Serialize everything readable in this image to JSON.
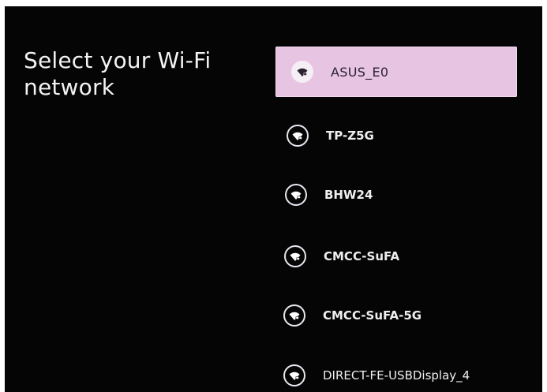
{
  "page": {
    "title": "Select your Wi-Fi network"
  },
  "networks": [
    {
      "ssid": "ASUS_E0",
      "selected": true,
      "icon": "wifi-lock-icon"
    },
    {
      "ssid": "TP-Z5G",
      "selected": false,
      "icon": "wifi-lock-icon"
    },
    {
      "ssid": "BHW24",
      "selected": false,
      "icon": "wifi-lock-icon"
    },
    {
      "ssid": "CMCC-SuFA",
      "selected": false,
      "icon": "wifi-lock-icon"
    },
    {
      "ssid": "CMCC-SuFA-5G",
      "selected": false,
      "icon": "wifi-lock-icon"
    },
    {
      "ssid": "DIRECT-FE-USBDisplay_4",
      "selected": false,
      "icon": "wifi-lock-icon"
    }
  ],
  "colors": {
    "background": "#050505",
    "selected_background": "#e8c4e3",
    "text": "#efefef",
    "selected_text": "#2a2230"
  }
}
